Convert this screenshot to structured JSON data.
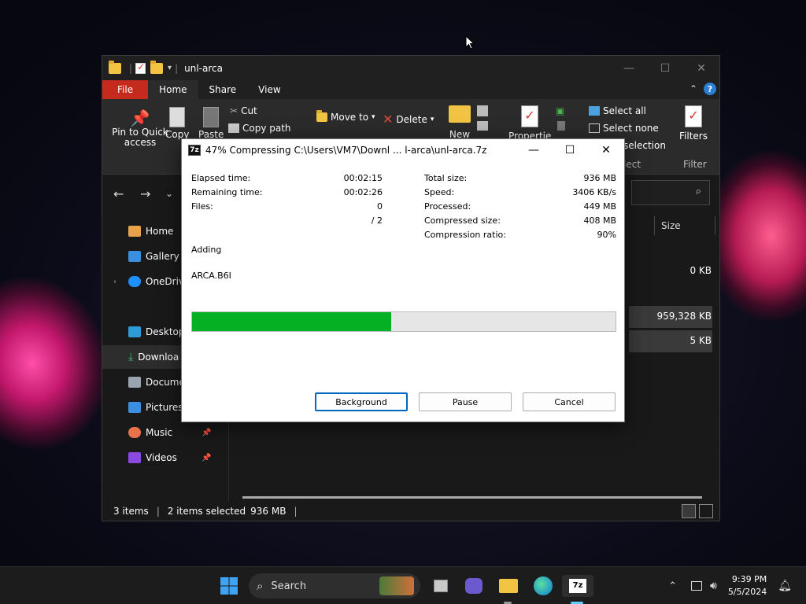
{
  "explorer": {
    "title": "unl-arca",
    "ribbon_tabs": [
      "File",
      "Home",
      "Share",
      "View"
    ],
    "ribbon": {
      "pin_label": "Pin to Quick access",
      "copy_label": "Copy",
      "paste_label": "Paste",
      "cut_label": "Cut",
      "copy_path_label": "Copy path",
      "move_to_label": "Move to",
      "delete_label": "Delete",
      "new_label": "New",
      "properties_label": "Properties",
      "select_all_label": "Select all",
      "select_none_label": "Select none",
      "invert_label": "selection",
      "select_group": "lect",
      "filters_label": "Filters",
      "filter_group": "Filter"
    },
    "column_size": "Size",
    "sizes": [
      "0 KB",
      "959,328 KB",
      "5 KB"
    ],
    "nav_items": [
      "Home",
      "Gallery",
      "OneDrive",
      "Desktop",
      "Downloa",
      "Docume",
      "Pictures",
      "Music",
      "Videos"
    ],
    "status": {
      "items": "3 items",
      "selected": "2 items selected",
      "selected_size": "936 MB"
    }
  },
  "dialog": {
    "title": "47% Compressing C:\\Users\\VM7\\Downl ... l-arca\\unl-arca.7z",
    "app_icon": "7z",
    "left": [
      {
        "label": "Elapsed time:",
        "value": "00:02:15"
      },
      {
        "label": "Remaining time:",
        "value": "00:02:26"
      },
      {
        "label": "Files:",
        "value": "0"
      },
      {
        "label": "",
        "value": "/ 2"
      }
    ],
    "right": [
      {
        "label": "Total size:",
        "value": "936 MB"
      },
      {
        "label": "Speed:",
        "value": "3406 KB/s"
      },
      {
        "label": "Processed:",
        "value": "449 MB"
      },
      {
        "label": "Compressed size:",
        "value": "408 MB"
      },
      {
        "label": "Compression ratio:",
        "value": "90%"
      }
    ],
    "action": "Adding",
    "current_file": "ARCA.B6I",
    "progress_percent": 47,
    "buttons": {
      "background": "Background",
      "pause": "Pause",
      "cancel": "Cancel"
    }
  },
  "taskbar": {
    "search_label": "Search",
    "time": "9:39 PM",
    "date": "5/5/2024"
  },
  "colors": {
    "accent": "#0067c0",
    "progress": "#06b025",
    "file_tab": "#c42b1c"
  }
}
